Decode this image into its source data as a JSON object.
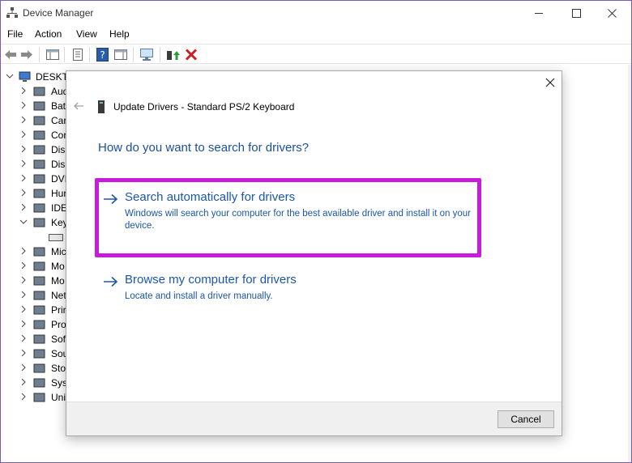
{
  "window": {
    "title": "Device Manager"
  },
  "menu": [
    "File",
    "Action",
    "View",
    "Help"
  ],
  "tree": {
    "root": "DESKTO",
    "items": [
      {
        "label": "Aud",
        "icon": "audio-icon"
      },
      {
        "label": "Bat",
        "icon": "battery-icon"
      },
      {
        "label": "Car",
        "icon": "camera-icon"
      },
      {
        "label": "Cor",
        "icon": "monitor-icon"
      },
      {
        "label": "Disl",
        "icon": "disk-icon"
      },
      {
        "label": "Dis",
        "icon": "display-icon"
      },
      {
        "label": "DVI",
        "icon": "dvd-icon"
      },
      {
        "label": "Hur",
        "icon": "hid-icon"
      },
      {
        "label": "IDE",
        "icon": "ide-icon"
      },
      {
        "label": "Key",
        "icon": "keyboard-icon"
      },
      {
        "label": "Mic",
        "icon": "mic-icon"
      },
      {
        "label": "Mo",
        "icon": "mouse-icon"
      },
      {
        "label": "Mo",
        "icon": "monitor-icon"
      },
      {
        "label": "Net",
        "icon": "network-icon"
      },
      {
        "label": "Prir",
        "icon": "printer-icon"
      },
      {
        "label": "Pro",
        "icon": "processor-icon"
      },
      {
        "label": "Sof",
        "icon": "software-icon"
      },
      {
        "label": "Sou",
        "icon": "sound-icon"
      },
      {
        "label": "Sto",
        "icon": "storage-icon"
      },
      {
        "label": "Sys",
        "icon": "system-icon"
      },
      {
        "label": "Uni",
        "icon": "usb-icon"
      }
    ]
  },
  "dialog": {
    "title": "Update Drivers - Standard PS/2 Keyboard",
    "heading": "How do you want to search for drivers?",
    "option_auto": {
      "title": "Search automatically for drivers",
      "desc": "Windows will search your computer for the best available driver and install it on your device."
    },
    "option_browse": {
      "title": "Browse my computer for drivers",
      "desc": "Locate and install a driver manually."
    },
    "cancel_label": "Cancel"
  },
  "colors": {
    "accent": "#1b57a8",
    "highlight": "#c91cdb",
    "delete": "#d11f1f"
  }
}
